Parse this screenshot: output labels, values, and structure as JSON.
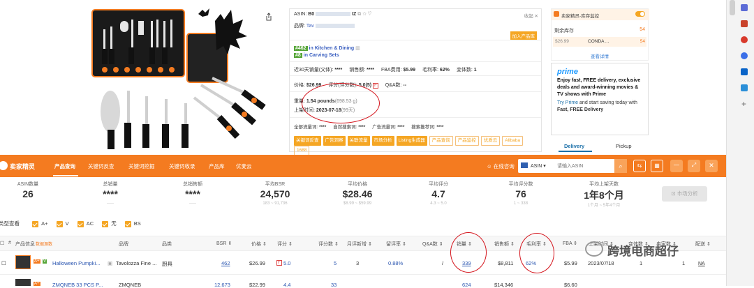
{
  "product_panel": {
    "asin_label": "ASIN:",
    "asin_value": "B0",
    "asin_tail": "IZ",
    "brand_label": "品牌:",
    "brand_value": "Tav",
    "collapse": "收起",
    "add_to_product_lib": "加入产品库",
    "rank1_num": "#462",
    "rank1_in": "in",
    "rank1_cat": "Kitchen & Dining",
    "rank2_num": "#8",
    "rank2_in": "in",
    "rank2_cat": "Carving Sets",
    "sales30_label": "近30天销量(父体):",
    "sales30_value": "****",
    "revenue_label": "销售额:",
    "revenue_value": "****",
    "fba_label": "FBA费用:",
    "fba_value": "$5.99",
    "margin_label": "毛利率:",
    "margin_value": "62%",
    "variants_label": "变体数:",
    "variants_value": "1",
    "price_label": "价格:",
    "price_value": "$26.99",
    "rating_label": "评分(评分数):",
    "rating_value": "5.0(5)",
    "rating_flag": "F",
    "qa_label": "Q&A数:",
    "qa_value": "--",
    "weight_label": "重量:",
    "weight_value": "1.54 pounds",
    "weight_grams": "(698.53 g)",
    "launch_label": "上架时间:",
    "launch_value": "2023-07-18",
    "launch_days": "(99天)",
    "kw_all_label": "全部流量词:",
    "kw_all_value": "****",
    "kw_natural_label": "自然搜索词:",
    "kw_natural_value": "****",
    "kw_ad_label": "广告流量词:",
    "kw_ad_value": "****",
    "kw_rec_label": "搜索推荐词:",
    "kw_rec_value": "****",
    "tags_solid": [
      "关键词反查",
      "广告洞察",
      "关联流量",
      "市场分析",
      "Listing生成器"
    ],
    "tags_outline": [
      "产品查询",
      "产品监控",
      "优质云",
      "Alibaba",
      "1688"
    ]
  },
  "inventory": {
    "title": "卖家精灵-库存监控",
    "remaining_label": "剩余库存",
    "remaining_value": "54",
    "price": "$26.99",
    "seller": "CONDA ...",
    "qty": "54",
    "details": "查看详情"
  },
  "prime": {
    "logo": "prime",
    "line1": "Enjoy fast, FREE delivery, exclusive deals and award-winning movies & TV shows with Prime",
    "line2a": "Try Prime",
    "line2b": "and start saving today with",
    "line2c": "Fast, FREE Delivery",
    "tab_delivery": "Delivery",
    "tab_pickup": "Pickup"
  },
  "toolbar": {
    "brand": "卖家精灵",
    "nav": [
      "产品查询",
      "关键词反查",
      "关键词挖掘",
      "关键词收录",
      "产品库",
      "优麦云"
    ],
    "online_consult": "在线咨询",
    "asin_select": "ASIN",
    "search_placeholder": "请输入ASIN",
    "country": "US"
  },
  "stats": [
    {
      "label": "ASIN数量",
      "value": "26",
      "sub": ""
    },
    {
      "label": "总销量",
      "value": "****",
      "sub": "-----"
    },
    {
      "label": "总销售额",
      "value": "****",
      "sub": "-----"
    },
    {
      "label": "平均BSR",
      "value": "24,570",
      "sub": "183 ~ 91,736"
    },
    {
      "label": "平均价格",
      "value": "$28.46",
      "sub": "$8.99 ~ $59.99"
    },
    {
      "label": "平均评分",
      "value": "4.7",
      "sub": "4.3 ~ 5.0"
    },
    {
      "label": "平均评分数",
      "value": "76",
      "sub": "1 ~ 338"
    },
    {
      "label": "平均上架天数",
      "value": "1年8个月",
      "sub": "1个月 ~ 5年4个月"
    }
  ],
  "market_analysis": "市场分析",
  "filters": {
    "label": "类型查看",
    "options": [
      "A+",
      "V",
      "AC",
      "无",
      "BS"
    ]
  },
  "table": {
    "headers": [
      "#",
      "产品信息",
      "数据源数",
      "品牌",
      "品类",
      "BSR",
      "价格",
      "评分",
      "评分数",
      "月评新增",
      "留评率",
      "Q&A数",
      "销量",
      "销售额",
      "毛利率",
      "FBA",
      "上架时间",
      "变体数",
      "卖家数",
      "配送"
    ],
    "row1": {
      "title": "Halloween Pumpki...",
      "brand": "Tavolozza Fine ...",
      "category": "厨具",
      "bsr": "462",
      "price": "$26.99",
      "rating_flag": "F",
      "rating": "5.0",
      "reviews": "5",
      "monthly_new": "3",
      "review_rate": "0.88%",
      "qa": "/",
      "sales": "339",
      "revenue": "$8,811",
      "margin": "62%",
      "fba": "$5.99",
      "launch": "2023/07/18",
      "variants": "1",
      "sellers": "1",
      "delivery": "NA"
    },
    "row2": {
      "title": "ZMQNEB 33 PCS P...",
      "brand": "ZMQNEB",
      "bsr": "12,673",
      "price": "$22.99",
      "rating": "4.4",
      "reviews": "33",
      "sales": "624",
      "revenue": "$14,346",
      "fba": "$6.60"
    }
  },
  "watermark": "跨境电商超仔"
}
